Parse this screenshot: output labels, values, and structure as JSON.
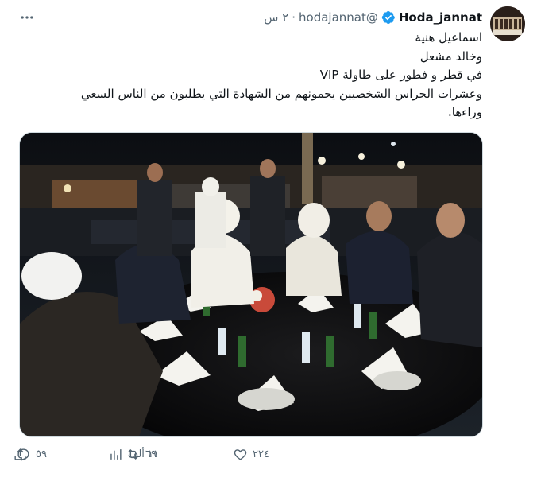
{
  "tweet": {
    "author_name": "Hoda_jannat",
    "author_handle": "@hodajannat",
    "separator": "·",
    "time": "٢ س",
    "lines": [
      "اسماعيل هنية",
      "وخالد مشعل",
      "في قطر و فطور على طاولة VIP",
      "وعشرات الحراس الشخصيين يحمونهم من الشهادة التي يطلبون من الناس السعي",
      "وراءها."
    ]
  },
  "actions": {
    "replies": "٥٩",
    "retweets": "٦٩",
    "likes": "٢٢٤",
    "views": "١١ ألف"
  },
  "icons": {
    "verified": "verified-badge-icon",
    "more": "more-icon",
    "reply": "reply-icon",
    "retweet": "retweet-icon",
    "like": "like-icon",
    "views": "views-icon",
    "share": "share-icon"
  },
  "colors": {
    "verified": "#1d9bf0",
    "text": "#0f1419",
    "secondary": "#536471"
  }
}
